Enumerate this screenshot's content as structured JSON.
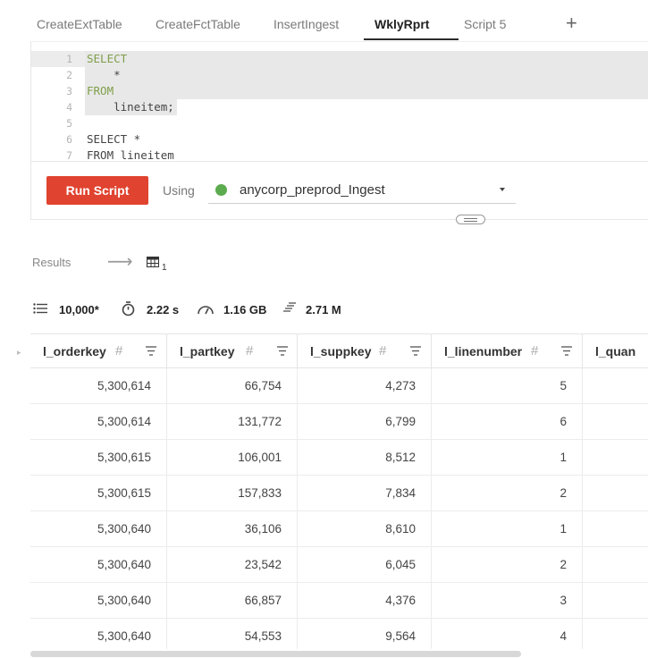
{
  "tabs": [
    {
      "label": "CreateExtTable",
      "active": false
    },
    {
      "label": "CreateFctTable",
      "active": false
    },
    {
      "label": "InsertIngest",
      "active": false
    },
    {
      "label": "WklyRprt",
      "active": true
    },
    {
      "label": "Script 5",
      "active": false
    }
  ],
  "add_tab_icon": "plus-icon",
  "editor": {
    "lines": [
      {
        "num": "1",
        "text": "SELECT"
      },
      {
        "num": "2",
        "text": "    *"
      },
      {
        "num": "3",
        "text": "FROM"
      },
      {
        "num": "4",
        "text": "    lineitem;"
      },
      {
        "num": "5",
        "text": ""
      },
      {
        "num": "6",
        "text": "SELECT *"
      },
      {
        "num": "7",
        "text": "FROM lineitem"
      }
    ]
  },
  "run_button": "Run Script",
  "using_label": "Using",
  "connection": {
    "name": "anycorp_preprod_Ingest",
    "status_color": "#5cab4e"
  },
  "results": {
    "label": "Results",
    "result_count": "1"
  },
  "stats": {
    "rows": "10,000*",
    "duration": "2.22 s",
    "size": "1.16 GB",
    "scanned": "2.71 M"
  },
  "table": {
    "columns": [
      "l_orderkey",
      "l_partkey",
      "l_suppkey",
      "l_linenumber",
      "l_quan"
    ],
    "rows": [
      [
        "5,300,614",
        "66,754",
        "4,273",
        "5"
      ],
      [
        "5,300,614",
        "131,772",
        "6,799",
        "6"
      ],
      [
        "5,300,615",
        "106,001",
        "8,512",
        "1"
      ],
      [
        "5,300,615",
        "157,833",
        "7,834",
        "2"
      ],
      [
        "5,300,640",
        "36,106",
        "8,610",
        "1"
      ],
      [
        "5,300,640",
        "23,542",
        "6,045",
        "2"
      ],
      [
        "5,300,640",
        "66,857",
        "4,376",
        "3"
      ],
      [
        "5,300,640",
        "54,553",
        "9,564",
        "4"
      ]
    ]
  },
  "accent_color": "#e0432f"
}
